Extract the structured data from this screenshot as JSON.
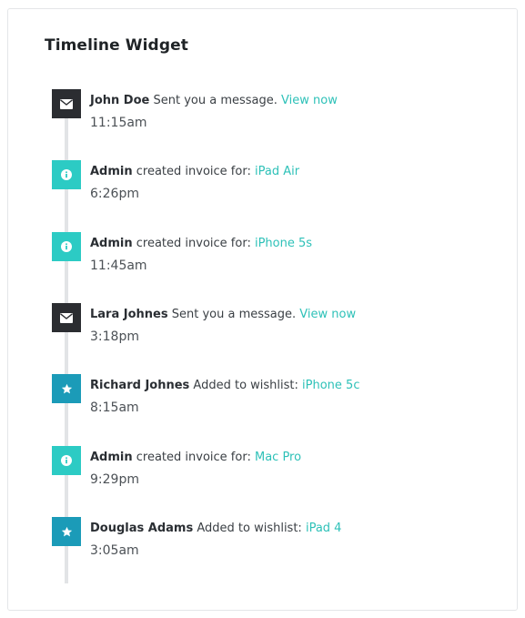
{
  "widget": {
    "title": "Timeline Widget"
  },
  "colors": {
    "message_icon_bg": "#2b2d31",
    "invoice_icon_bg": "#2ccbc4",
    "wishlist_icon_bg": "#1b9bb8",
    "link": "#2ec1b8",
    "timeline_line": "#e2e4e6"
  },
  "timeline": [
    {
      "icon": "envelope-icon",
      "actor": "John Doe",
      "action": "Sent you a message.",
      "link": "View now",
      "time": "11:15am"
    },
    {
      "icon": "info-icon",
      "actor": "Admin",
      "action": "created invoice for:",
      "link": "iPad Air",
      "time": "6:26pm"
    },
    {
      "icon": "info-icon",
      "actor": "Admin",
      "action": "created invoice for:",
      "link": "iPhone 5s",
      "time": "11:45am"
    },
    {
      "icon": "envelope-icon",
      "actor": "Lara Johnes",
      "action": "Sent you a message.",
      "link": "View now",
      "time": "3:18pm"
    },
    {
      "icon": "star-icon",
      "actor": "Richard Johnes",
      "action": "Added to wishlist:",
      "link": "iPhone 5c",
      "time": "8:15am"
    },
    {
      "icon": "info-icon",
      "actor": "Admin",
      "action": "created invoice for:",
      "link": "Mac Pro",
      "time": "9:29pm"
    },
    {
      "icon": "star-icon",
      "actor": "Douglas Adams",
      "action": "Added to wishlist:",
      "link": "iPad 4",
      "time": "3:05am"
    }
  ]
}
